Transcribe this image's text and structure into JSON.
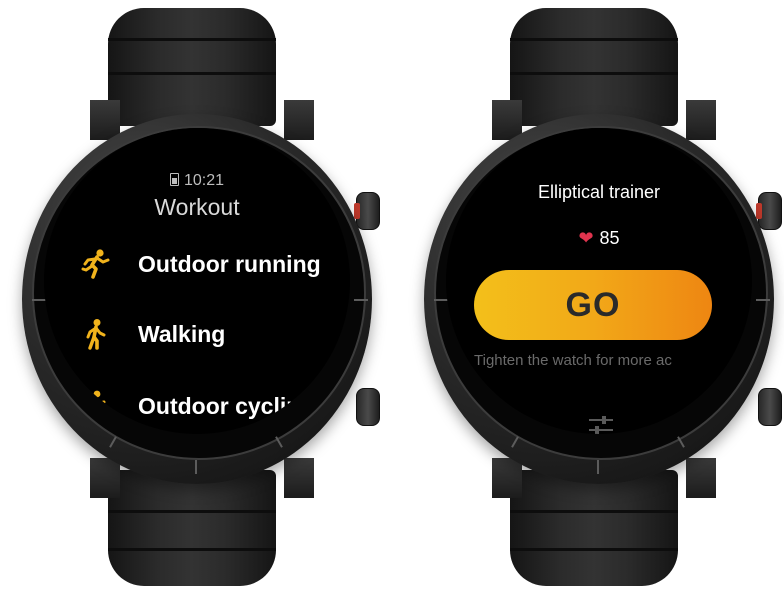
{
  "left_watch": {
    "status_time": "10:21",
    "title": "Workout",
    "items": [
      {
        "label": "Outdoor running",
        "icon": "running-icon"
      },
      {
        "label": "Walking",
        "icon": "walking-icon"
      },
      {
        "label": "Outdoor cycling",
        "icon": "cycling-icon"
      }
    ]
  },
  "right_watch": {
    "title": "Elliptical trainer",
    "heart_rate": "85",
    "go_label": "GO",
    "tip": "Tighten the watch for more ac",
    "settings_icon": "sliders-icon"
  },
  "colors": {
    "accent_yellow": "#f3c01a",
    "accent_orange": "#ee8612",
    "heart_red": "#e0344e",
    "crown_ring": "#c0392b"
  }
}
